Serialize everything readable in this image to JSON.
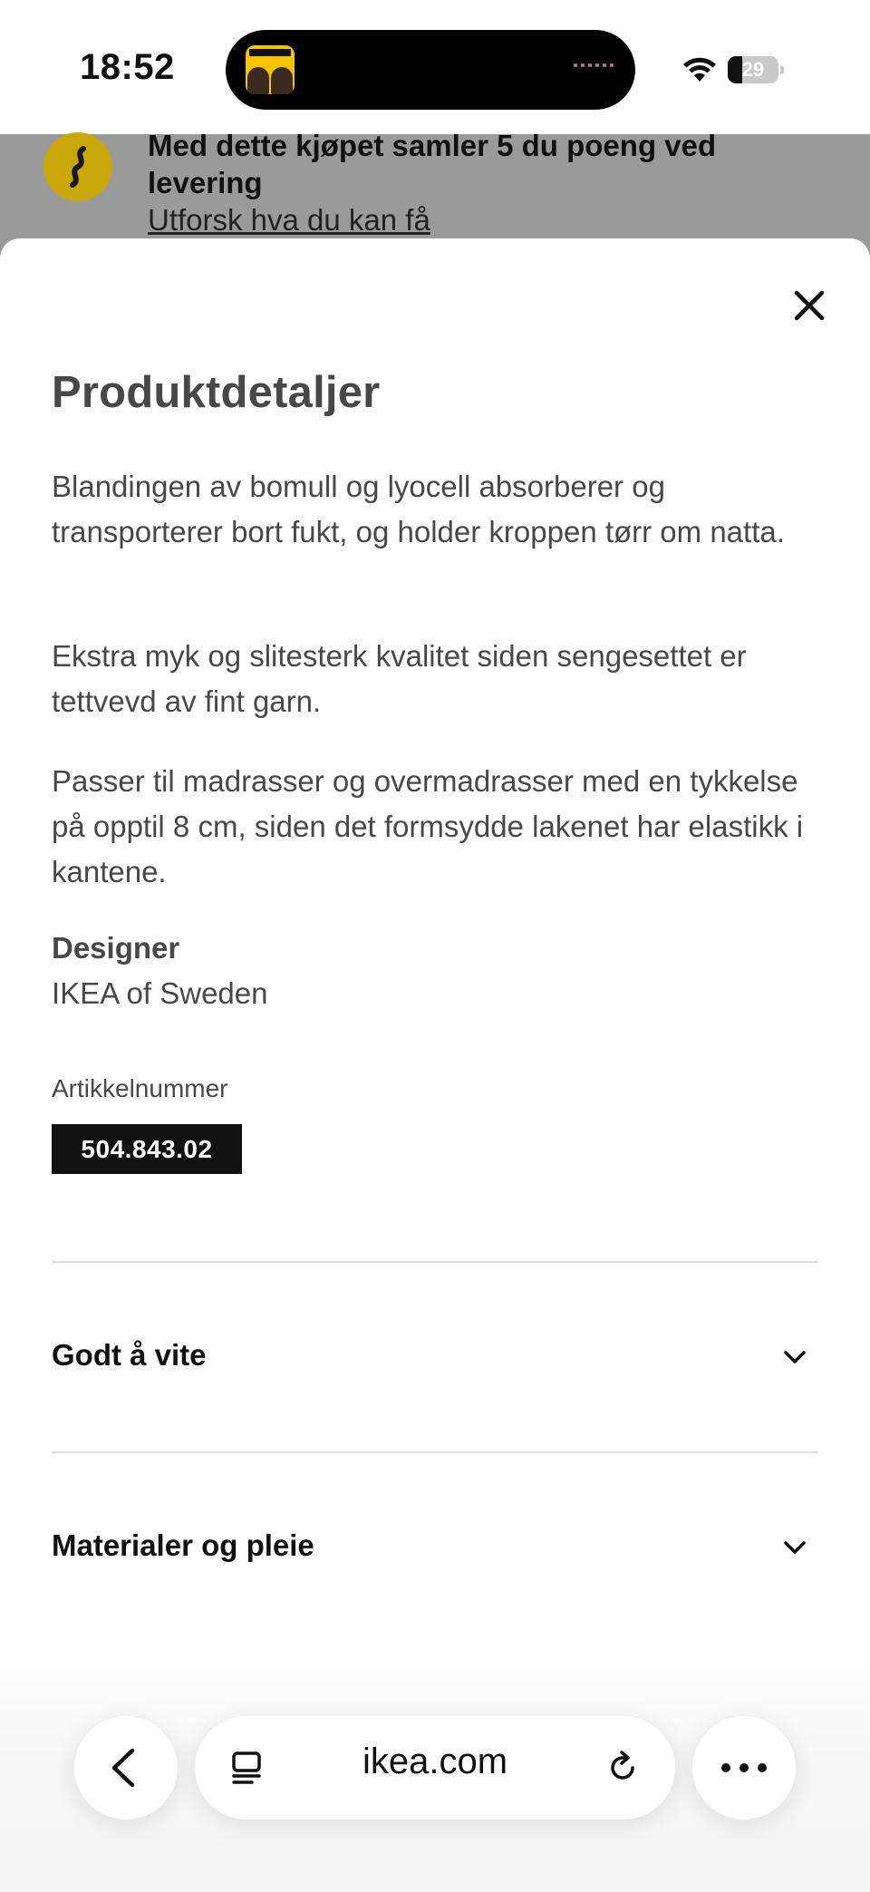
{
  "status_bar": {
    "time": "18:52",
    "battery_level": "29",
    "battery_fraction": 0.29,
    "icons": [
      "wifi-icon",
      "battery-icon"
    ]
  },
  "background_page": {
    "points_message": "Med dette kjøpet samler 5 du poeng ved levering",
    "points_link": "Utforsk hva du kan få",
    "icon": "ikea-family-icon",
    "icon_color": "#c9a70a"
  },
  "sheet": {
    "title": "Produktdetaljer",
    "paragraphs": [
      "Blandingen av bomull og lyocell absorberer og transporterer bort fukt, og holder kroppen tørr om natta.",
      "Ekstra myk og slitesterk kvalitet siden sengesettet er tettvevd av fint garn.",
      "Passer til madrasser og overmadrasser med en tykkelse på opptil 8 cm, siden det formsydde lakenet har elastikk i kantene."
    ],
    "designer_label": "Designer",
    "designer_value": "IKEA of Sweden",
    "article_label": "Artikkelnummer",
    "article_number": "504.843.02",
    "accordions": [
      {
        "title": "Godt å vite",
        "icon": "chevron-down-icon"
      },
      {
        "title": "Materialer og pleie",
        "icon": "chevron-down-icon"
      }
    ],
    "close_icon": "close-icon"
  },
  "browser_toolbar": {
    "address": "ikea.com",
    "icons": [
      "back-icon",
      "tabs-icon",
      "reload-icon",
      "more-icon"
    ]
  },
  "colors": {
    "text": "#484848",
    "heading": "#111111",
    "article_badge": "#111111",
    "backdrop": "#9a9a9a"
  }
}
